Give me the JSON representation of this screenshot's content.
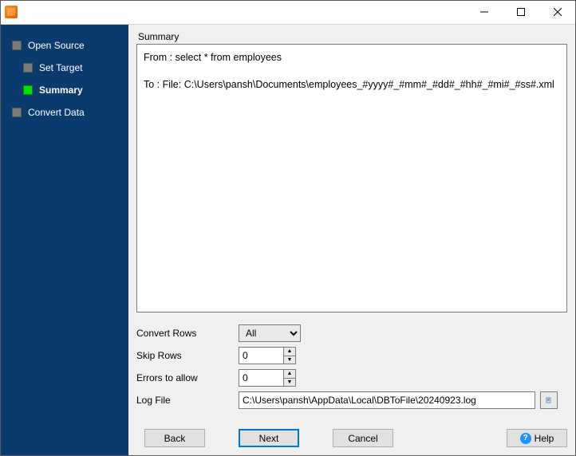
{
  "sidebar": {
    "items": [
      {
        "label": "Open Source",
        "indent": 0,
        "active": false
      },
      {
        "label": "Set Target",
        "indent": 1,
        "active": false
      },
      {
        "label": "Summary",
        "indent": 1,
        "active": true
      },
      {
        "label": "Convert Data",
        "indent": 0,
        "active": false
      }
    ]
  },
  "summary": {
    "group_label": "Summary",
    "from_line": "From : select * from employees",
    "to_line": "To : File: C:\\Users\\pansh\\Documents\\employees_#yyyy#_#mm#_#dd#_#hh#_#mi#_#ss#.xml"
  },
  "form": {
    "convert_rows_label": "Convert Rows",
    "convert_rows_value": "All",
    "skip_rows_label": "Skip Rows",
    "skip_rows_value": "0",
    "errors_label": "Errors to allow",
    "errors_value": "0",
    "logfile_label": "Log File",
    "logfile_value": "C:\\Users\\pansh\\AppData\\Local\\DBToFile\\20240923.log"
  },
  "footer": {
    "back": "Back",
    "next": "Next",
    "cancel": "Cancel",
    "help": "Help"
  }
}
